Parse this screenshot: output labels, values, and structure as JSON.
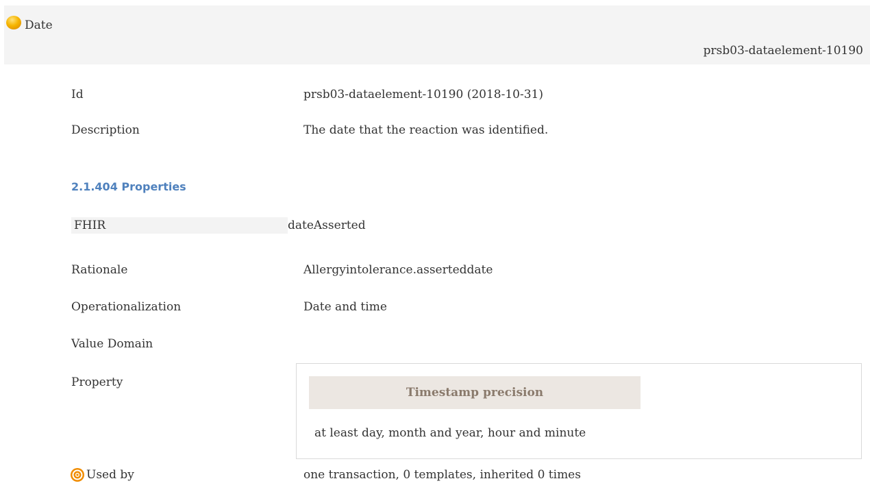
{
  "header": {
    "title": "Date",
    "id": "prsb03-dataelement-10190",
    "status_icon": "status-circle-icon",
    "status_color": "#f6b500"
  },
  "details": {
    "id_label": "Id",
    "id_value": "prsb03-dataelement-10190 (2018-10-31)",
    "description_label": "Description",
    "description_value": "The date that the reaction was identified."
  },
  "properties": {
    "heading": "2.1.404 Properties",
    "fhir_label": "FHIR",
    "fhir_value": "dateAsserted",
    "rationale_label": "Rationale",
    "rationale_value": "Allergyintolerance.asserteddate",
    "operationalization_label": "Operationalization",
    "operationalization_value": "Date and time",
    "value_domain_label": "Value Domain",
    "property_label": "Property",
    "property_box": {
      "header": "Timestamp precision",
      "value": "at least day, month and year, hour and minute"
    },
    "used_by_label": "Used by",
    "used_by_icon": "target-icon",
    "used_by_value": "one transaction, 0 templates, inherited 0 times"
  },
  "colors": {
    "heading": "#4f81bd",
    "header_bg": "#f4f4f4",
    "property_header_bg": "#ece7e2",
    "used_by_icon": "#f08c00"
  }
}
